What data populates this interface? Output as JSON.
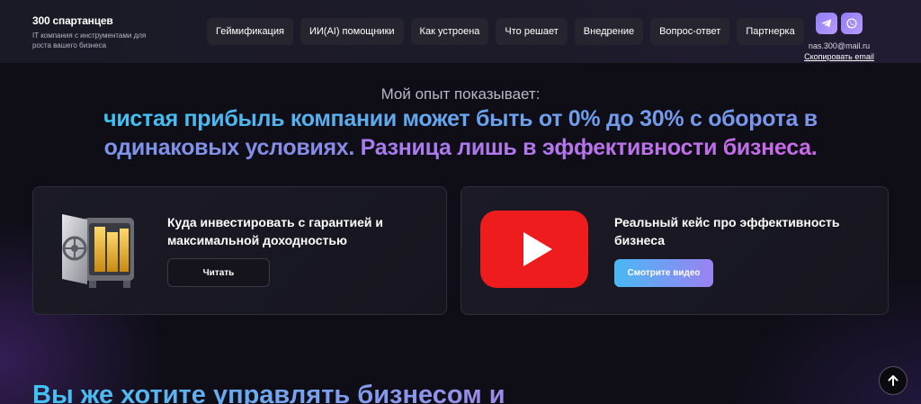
{
  "brand": {
    "name": "300 спартанцев",
    "tagline": "IT компания с инструментами для роста вашего бизнеса"
  },
  "nav": {
    "items": [
      {
        "label": "Геймификация"
      },
      {
        "label": "ИИ(AI) помощники"
      },
      {
        "label": "Как устроена"
      },
      {
        "label": "Что решает"
      },
      {
        "label": "Внедрение"
      },
      {
        "label": "Вопрос-ответ"
      },
      {
        "label": "Партнерка"
      }
    ]
  },
  "contacts": {
    "messengers": [
      {
        "icon": "telegram-icon"
      },
      {
        "icon": "whatsapp-icon"
      }
    ],
    "email": "nas.300@mail.ru",
    "copy_label": "Скопировать email"
  },
  "hero": {
    "eyebrow": "Мой опыт показывает:",
    "headline_part1": "чистая прибыль компании может быть от 0% до 30% с оборота в одинаковых условиях.",
    "headline_part2": "Разница лишь в эффективности бизнеса."
  },
  "cards": [
    {
      "icon": "safe-icon",
      "title": "Куда инвестировать с гарантией и максимальной доходностью",
      "button": "Читать"
    },
    {
      "icon": "youtube-play-icon",
      "title": "Реальный кейс про эффективность бизнеса",
      "button": "Смотрите видео"
    }
  ],
  "lower_heading": "Вы же хотите управлять бизнесом и",
  "colors": {
    "accent_blue": "#3fc3f2",
    "accent_violet": "#9a82f2",
    "accent_pink": "#c86ae6",
    "youtube_red": "#ee1c1c",
    "background": "#0f0e17"
  },
  "scroll_top": {
    "icon": "arrow-up-icon"
  }
}
